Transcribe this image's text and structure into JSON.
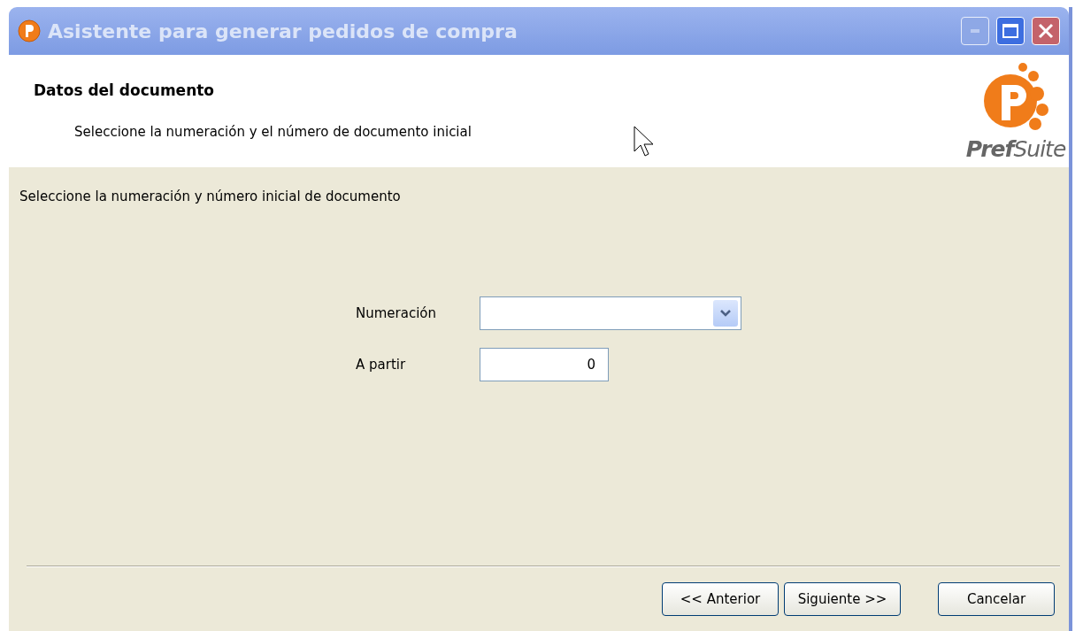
{
  "window": {
    "title": "Asistente para generar pedidos de compra",
    "active": false
  },
  "header": {
    "title": "Datos del documento",
    "subtitle": "Seleccione la numeración y el número de documento inicial",
    "logo_text": "**Pref**Suite"
  },
  "instruction": "Seleccione la numeración y número inicial de documento",
  "fields": [
    {
      "kind": "dropdown",
      "label": "Numeración"
    },
    {
      "kind": "text",
      "label": "A partir",
      "value": "0"
    }
  ],
  "buttons": [
    {
      "label": "<< Anterior"
    },
    {
      "label": "Siguiente >>"
    },
    {
      "label": "Cancelar"
    }
  ]
}
